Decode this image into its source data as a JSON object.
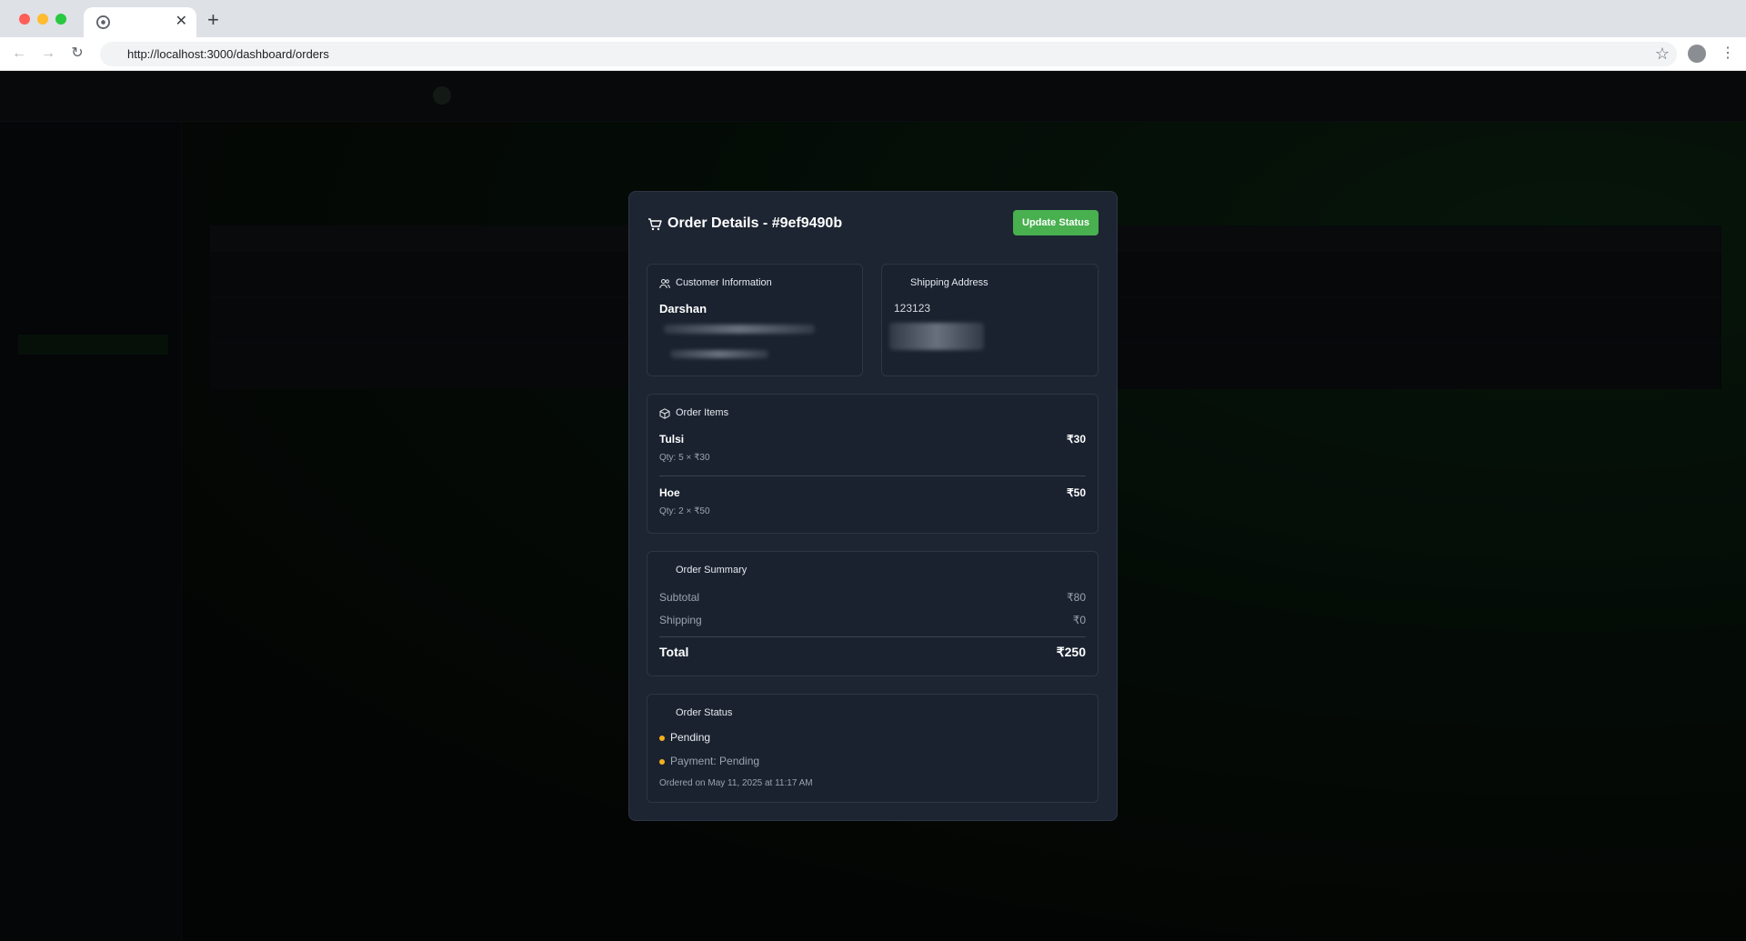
{
  "browser": {
    "url": "http://localhost:3000/dashboard/orders"
  },
  "modal": {
    "title": "Order Details - #9ef9490b",
    "update_button": "Update Status",
    "customer": {
      "heading": "Customer Information",
      "name": "Darshan"
    },
    "shipping": {
      "heading": "Shipping Address",
      "line1": "123123"
    },
    "items": {
      "heading": "Order Items",
      "list": [
        {
          "name": "Tulsi",
          "price": "₹30",
          "qty": "Qty: 5 × ₹30"
        },
        {
          "name": "Hoe",
          "price": "₹50",
          "qty": "Qty: 2 × ₹50"
        }
      ]
    },
    "summary": {
      "heading": "Order Summary",
      "subtotal_label": "Subtotal",
      "subtotal_value": "₹80",
      "shipping_label": "Shipping",
      "shipping_value": "₹0",
      "total_label": "Total",
      "total_value": "₹250"
    },
    "status": {
      "heading": "Order Status",
      "order_status": "Pending",
      "payment_status": "Payment: Pending",
      "ordered_on": "Ordered on May 11, 2025 at 11:17 AM"
    }
  },
  "colors": {
    "accent": "#48b04f",
    "status_dot": "#f2b01e",
    "modal_bg": "#1d2532"
  }
}
